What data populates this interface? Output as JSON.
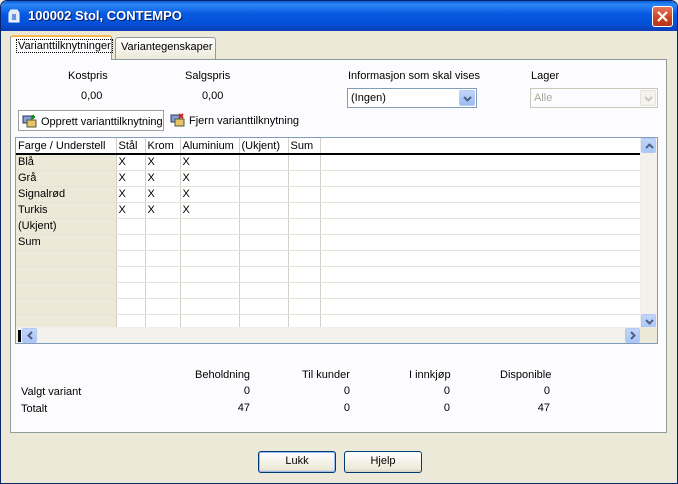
{
  "window": {
    "title": "100002 Stol, CONTEMPO",
    "title_color": "#0a5fdc"
  },
  "tabs": [
    {
      "label": "Varianttilknytninger",
      "active": true
    },
    {
      "label": "Variantegenskaper",
      "active": false
    }
  ],
  "prices": {
    "cost_label": "Kostpris",
    "cost_value": "0,00",
    "sales_label": "Salgspris",
    "sales_value": "0,00"
  },
  "info": {
    "label": "Informasjon som skal vises",
    "selected": "(Ingen)"
  },
  "warehouse": {
    "label": "Lager",
    "selected": "Alle",
    "disabled": true
  },
  "toolbar": {
    "create_label": "Opprett varianttilknytning",
    "remove_label": "Fjern varianttilknytning"
  },
  "grid": {
    "columns": [
      "Farge / Understell",
      "Stål",
      "Krom",
      "Aluminium",
      "(Ukjent)",
      "Sum"
    ],
    "rows": [
      {
        "label": "Blå",
        "cells": [
          "X",
          "X",
          "X",
          "",
          ""
        ]
      },
      {
        "label": "Grå",
        "cells": [
          "X",
          "X",
          "X",
          "",
          ""
        ]
      },
      {
        "label": "Signalrød",
        "cells": [
          "X",
          "X",
          "X",
          "",
          ""
        ]
      },
      {
        "label": "Turkis",
        "cells": [
          "X",
          "X",
          "X",
          "",
          ""
        ]
      },
      {
        "label": "(Ukjent)",
        "cells": [
          "",
          "",
          "",
          "",
          ""
        ]
      },
      {
        "label": "Sum",
        "cells": [
          "",
          "",
          "",
          "",
          ""
        ]
      },
      {
        "label": "",
        "cells": [
          "",
          "",
          "",
          "",
          ""
        ]
      },
      {
        "label": "",
        "cells": [
          "",
          "",
          "",
          "",
          ""
        ]
      },
      {
        "label": "",
        "cells": [
          "",
          "",
          "",
          "",
          ""
        ]
      },
      {
        "label": "",
        "cells": [
          "",
          "",
          "",
          "",
          ""
        ]
      },
      {
        "label": "",
        "cells": [
          "",
          "",
          "",
          "",
          ""
        ]
      }
    ]
  },
  "summary": {
    "headers": [
      "Beholdning",
      "Til kunder",
      "I innkjøp",
      "Disponible"
    ],
    "rows": [
      {
        "label": "Valgt variant",
        "values": [
          "0",
          "0",
          "0",
          "0"
        ]
      },
      {
        "label": "Totalt",
        "values": [
          "47",
          "0",
          "0",
          "47"
        ]
      }
    ]
  },
  "buttons": {
    "close_label": "Lukk",
    "help_label": "Hjelp"
  },
  "icons": {
    "window": "app-icon",
    "close": "close-icon",
    "create": "create-link-icon",
    "remove": "remove-link-icon"
  }
}
